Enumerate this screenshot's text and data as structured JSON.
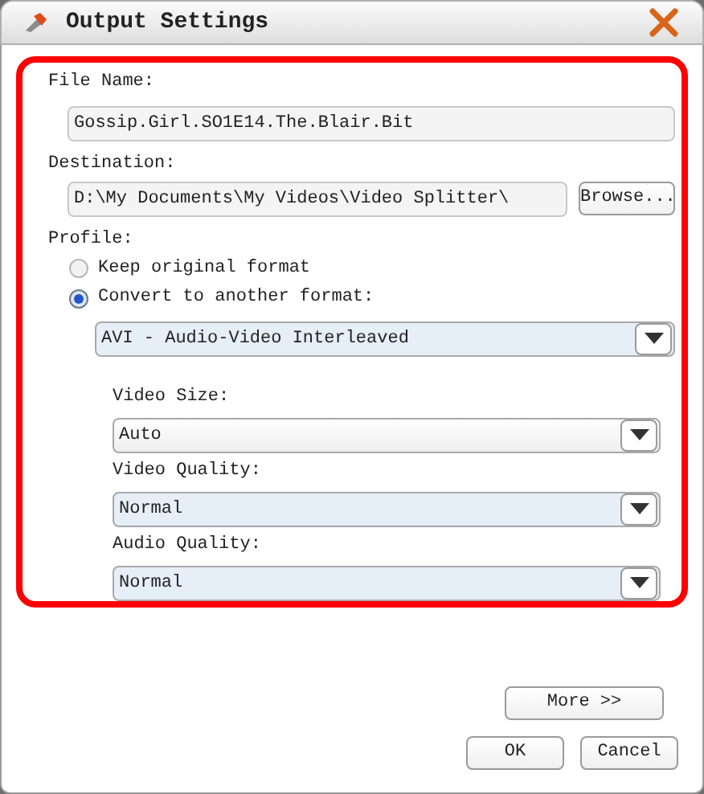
{
  "window": {
    "title": "Output Settings"
  },
  "file_name": {
    "label": "File Name:",
    "value": "Gossip.Girl.SO1E14.The.Blair.Bit"
  },
  "destination": {
    "label": "Destination:",
    "value": "D:\\My Documents\\My Videos\\Video Splitter\\",
    "browse_button": "Browse..."
  },
  "profile": {
    "label": "Profile:",
    "options": [
      {
        "label": "Keep original format",
        "selected": false
      },
      {
        "label": "Convert to another format:",
        "selected": true
      }
    ],
    "format": {
      "value": "AVI - Audio-Video Interleaved",
      "highlighted": true
    }
  },
  "settings": [
    {
      "label": "Video Size:",
      "value": "Auto",
      "highlighted": false
    },
    {
      "label": "Video Quality:",
      "value": "Normal",
      "highlighted": true
    },
    {
      "label": "Audio Quality:",
      "value": "Normal",
      "highlighted": true
    }
  ],
  "buttons": {
    "more": "More >>",
    "ok": "OK",
    "cancel": "Cancel"
  }
}
